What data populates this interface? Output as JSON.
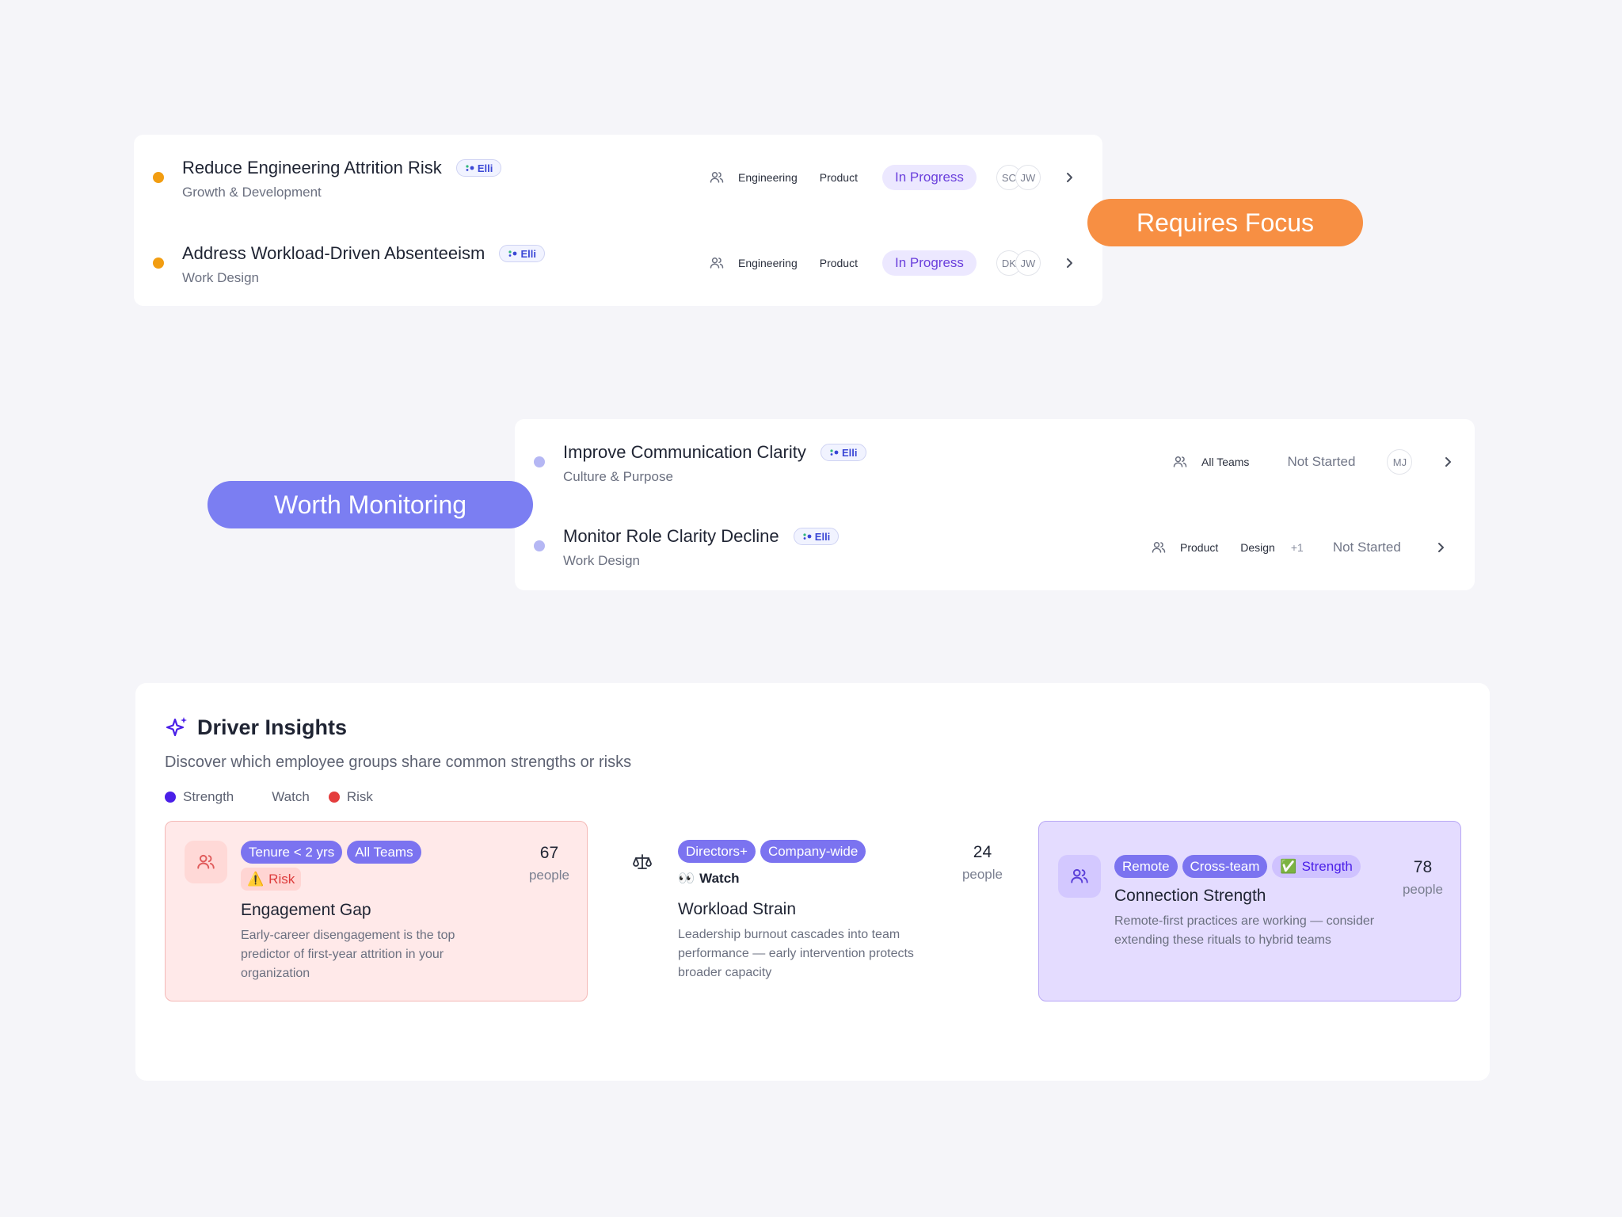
{
  "requires_focus": {
    "label": "Requires Focus",
    "color": "#f78f43",
    "rows": [
      {
        "title": "Reduce Engineering Attrition Risk",
        "badge": "Elli",
        "subtitle": "Growth & Development",
        "teams": [
          "Engineering",
          "Product"
        ],
        "status": "In Progress",
        "avatars": [
          "SC",
          "JW"
        ]
      },
      {
        "title": "Address Workload-Driven Absenteeism",
        "badge": "Elli",
        "subtitle": "Work Design",
        "teams": [
          "Engineering",
          "Product"
        ],
        "status": "In Progress",
        "avatars": [
          "DK",
          "JW"
        ]
      }
    ]
  },
  "worth_monitoring": {
    "label": "Worth Monitoring",
    "color": "#7b7ef2",
    "rows": [
      {
        "title": "Improve Communication Clarity",
        "badge": "Elli",
        "subtitle": "Culture & Purpose",
        "teams": [
          "All Teams"
        ],
        "status": "Not Started",
        "avatars": [
          "MJ"
        ]
      },
      {
        "title": "Monitor Role Clarity Decline",
        "badge": "Elli",
        "subtitle": "Work Design",
        "teams": [
          "Product",
          "Design"
        ],
        "more": "+1",
        "status": "Not Started"
      }
    ]
  },
  "driver_insights": {
    "title": "Driver Insights",
    "subtitle": "Discover which employee groups share common strengths or risks",
    "legend": [
      {
        "label": "Strength",
        "color": "#4a1fe8"
      },
      {
        "label": "Watch"
      },
      {
        "label": "Risk",
        "color": "#e43d3d"
      }
    ],
    "cards": [
      {
        "chips": [
          "Tenure < 2 yrs",
          "All Teams"
        ],
        "flag_icon": "⚠️",
        "flag": "Risk",
        "name": "Engagement Gap",
        "description": "Early-career disengagement is the top predictor of first-year attrition in your organization",
        "count": "67",
        "unit": "people",
        "icon": "people-icon"
      },
      {
        "chips": [
          "Directors+",
          "Company-wide"
        ],
        "flag_icon": "👀",
        "flag": "Watch",
        "name": "Workload Strain",
        "description": "Leadership burnout cascades into team performance — early intervention protects broader capacity",
        "count": "24",
        "unit": "people",
        "icon": "scale-icon"
      },
      {
        "chips": [
          "Remote",
          "Cross-team"
        ],
        "flag_icon": "✅",
        "flag": "Strength",
        "name": "Connection Strength",
        "description": "Remote-first practices are working — consider extending these rituals to hybrid teams",
        "count": "78",
        "unit": "people",
        "icon": "people-icon"
      }
    ]
  }
}
